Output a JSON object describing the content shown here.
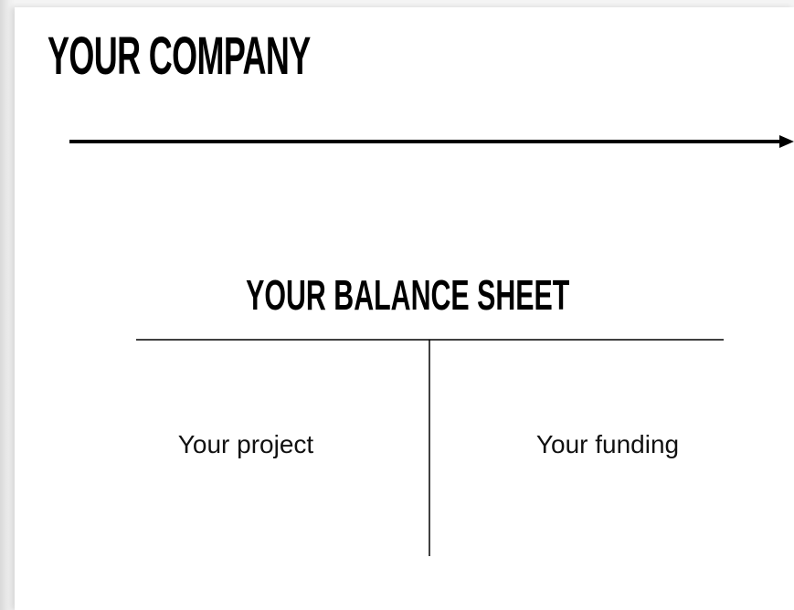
{
  "slide": {
    "company_title": "YOUR COMPANY",
    "balance_sheet_title": "YOUR BALANCE SHEET",
    "left_column_label": "Your project",
    "right_column_label": "Your funding"
  },
  "colors": {
    "text": "#000000",
    "background": "#ffffff",
    "page_edge": "#e6e6e6"
  },
  "icons": [
    "right-arrow-icon"
  ]
}
